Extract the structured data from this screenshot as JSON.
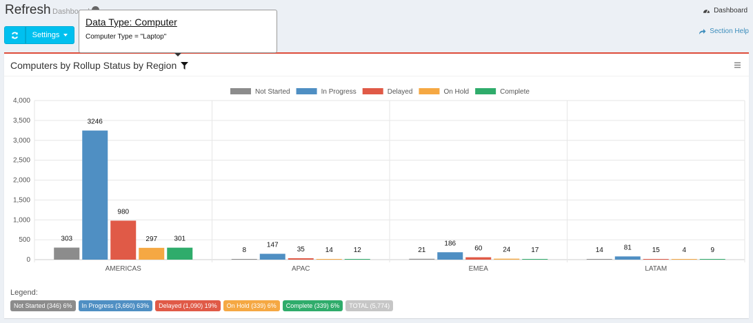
{
  "header": {
    "title": "Refresh",
    "breadcrumb": "Dashboard",
    "top_right_link": "Dashboard",
    "section_help": "Section Help"
  },
  "toolbar": {
    "settings_label": "Settings"
  },
  "tooltip": {
    "title": "Data Type: Computer",
    "body": "Computer Type = \"Laptop\""
  },
  "panel": {
    "title": "Computers by Rollup Status by Region",
    "legend_label": "Legend:"
  },
  "colors": {
    "accent": "#00c0ef",
    "box_border": "#dd4b39",
    "not_started": "#8c8c8c",
    "in_progress": "#4f8fc3",
    "delayed": "#e05a47",
    "on_hold": "#f5a843",
    "complete": "#2fac6b",
    "total": "#c6c6c6"
  },
  "chart_data": {
    "type": "bar",
    "categories": [
      "AMERICAS",
      "APAC",
      "EMEA",
      "LATAM"
    ],
    "series": [
      {
        "name": "Not Started",
        "values": [
          303,
          8,
          21,
          14
        ],
        "color": "#8c8c8c"
      },
      {
        "name": "In Progress",
        "values": [
          3246,
          147,
          186,
          81
        ],
        "color": "#4f8fc3"
      },
      {
        "name": "Delayed",
        "values": [
          980,
          35,
          60,
          15
        ],
        "color": "#e05a47"
      },
      {
        "name": "On Hold",
        "values": [
          297,
          14,
          24,
          4
        ],
        "color": "#f5a843"
      },
      {
        "name": "Complete",
        "values": [
          301,
          12,
          17,
          9
        ],
        "color": "#2fac6b"
      }
    ],
    "yticks": [
      "0",
      "500",
      "1,000",
      "1,500",
      "2,000",
      "2,500",
      "3,000",
      "3,500",
      "4,000"
    ],
    "ylim": [
      0,
      4000
    ],
    "grid": true,
    "legend_position": "top-center",
    "data_labels": true
  },
  "summary_badges": [
    {
      "label": "Not Started (346)  6%",
      "color": "#8c8c8c"
    },
    {
      "label": "In Progress (3,660)  63%",
      "color": "#4f8fc3"
    },
    {
      "label": "Delayed (1,090)  19%",
      "color": "#e05a47"
    },
    {
      "label": "On Hold (339)  6%",
      "color": "#f5a843"
    },
    {
      "label": "Complete (339)  6%",
      "color": "#2fac6b"
    },
    {
      "label": "TOTAL (5,774)",
      "color": "#c6c6c6"
    }
  ]
}
